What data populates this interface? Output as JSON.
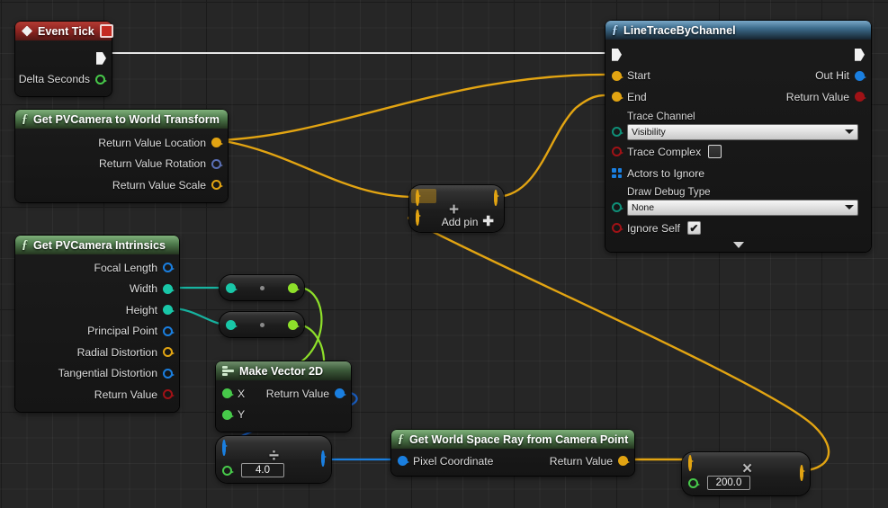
{
  "app": {
    "kind": "unreal-blueprint-graph",
    "background_color": "#262626"
  },
  "colors": {
    "exec_wire": "#e6e6e6",
    "vector_yellow": "#e2a412",
    "object_blue": "#1a7fe0",
    "bool_red": "#a01216",
    "float_green": "#47c94a",
    "int_teal": "#19c7a8",
    "enum_seagreen": "#0f8f78",
    "struct_darkblue": "#5a6fb5",
    "wire_light_green": "#8ee02a"
  },
  "nodes": {
    "event_tick": {
      "title": "Event Tick",
      "icon": "event-diamond-icon",
      "stop_icon": "event-stop-icon",
      "outputs": [
        {
          "label": "",
          "type": "exec"
        },
        {
          "label": "Delta Seconds",
          "type": "float"
        }
      ]
    },
    "camera_to_world": {
      "title": "Get PVCamera to World Transform",
      "icon": "function-icon",
      "outputs": [
        {
          "label": "Return Value Location",
          "type": "vector",
          "connected": true
        },
        {
          "label": "Return Value Rotation",
          "type": "rotator",
          "connected": false
        },
        {
          "label": "Return Value Scale",
          "type": "vector",
          "connected": false
        }
      ]
    },
    "camera_intrinsics": {
      "title": "Get PVCamera Intrinsics",
      "icon": "function-icon",
      "outputs": [
        {
          "label": "Focal Length",
          "type": "vector2d",
          "connected": false
        },
        {
          "label": "Width",
          "type": "int",
          "connected": true
        },
        {
          "label": "Height",
          "type": "int",
          "connected": true
        },
        {
          "label": "Principal Point",
          "type": "vector2d",
          "connected": false
        },
        {
          "label": "Radial Distortion",
          "type": "vector",
          "connected": false
        },
        {
          "label": "Tangential Distortion",
          "type": "vector2d",
          "connected": false
        },
        {
          "label": "Return Value",
          "type": "bool",
          "connected": false
        }
      ]
    },
    "conv_width": {
      "name": "int-to-float-conversion",
      "input_type": "int",
      "output_type": "float"
    },
    "conv_height": {
      "name": "int-to-float-conversion",
      "input_type": "int",
      "output_type": "float"
    },
    "make_vector_2d": {
      "title": "Make Vector 2D",
      "icon": "make-struct-icon",
      "inputs": [
        {
          "label": "X",
          "type": "float"
        },
        {
          "label": "Y",
          "type": "float"
        }
      ],
      "outputs": [
        {
          "label": "Return Value",
          "type": "vector2d"
        }
      ]
    },
    "divide": {
      "operator": "÷",
      "name": "divide-node",
      "input_a_type": "vector2d",
      "input_b_value": "4.0",
      "input_b_type": "float",
      "output_type": "vector2d"
    },
    "world_space_ray": {
      "title": "Get World Space Ray from Camera Point",
      "icon": "function-icon",
      "inputs": [
        {
          "label": "Pixel Coordinate",
          "type": "vector2d"
        }
      ],
      "outputs": [
        {
          "label": "Return Value",
          "type": "vector"
        }
      ]
    },
    "multiply": {
      "operator": "×",
      "name": "multiply-node",
      "input_a_type": "vector",
      "input_b_value": "200.0",
      "input_b_type": "float",
      "output_type": "vector"
    },
    "add": {
      "operator": "+",
      "name": "add-node",
      "add_pin_label": "Add pin",
      "add_pin_glyph": "✚",
      "input_a_type": "vector",
      "input_b_type": "vector",
      "output_type": "vector"
    },
    "line_trace": {
      "title": "LineTraceByChannel",
      "icon": "function-icon",
      "inputs": [
        {
          "label": "",
          "type": "exec"
        },
        {
          "label": "Start",
          "type": "vector"
        },
        {
          "label": "End",
          "type": "vector"
        }
      ],
      "trace_channel": {
        "label": "Trace Channel",
        "value": "Visibility",
        "type": "enum"
      },
      "trace_complex": {
        "label": "Trace Complex",
        "checked": false,
        "type": "bool"
      },
      "actors_to_ignore": {
        "label": "Actors to Ignore",
        "type": "array-object"
      },
      "draw_debug_type": {
        "label": "Draw Debug Type",
        "value": "None",
        "type": "enum"
      },
      "ignore_self": {
        "label": "Ignore Self",
        "checked": true,
        "checkmark": "✔",
        "type": "bool"
      },
      "outputs": [
        {
          "label": "",
          "type": "exec"
        },
        {
          "label": "Out Hit",
          "type": "struct-hitresult"
        },
        {
          "label": "Return Value",
          "type": "bool"
        }
      ],
      "collapse_icon": "collapse-arrow-icon"
    }
  }
}
